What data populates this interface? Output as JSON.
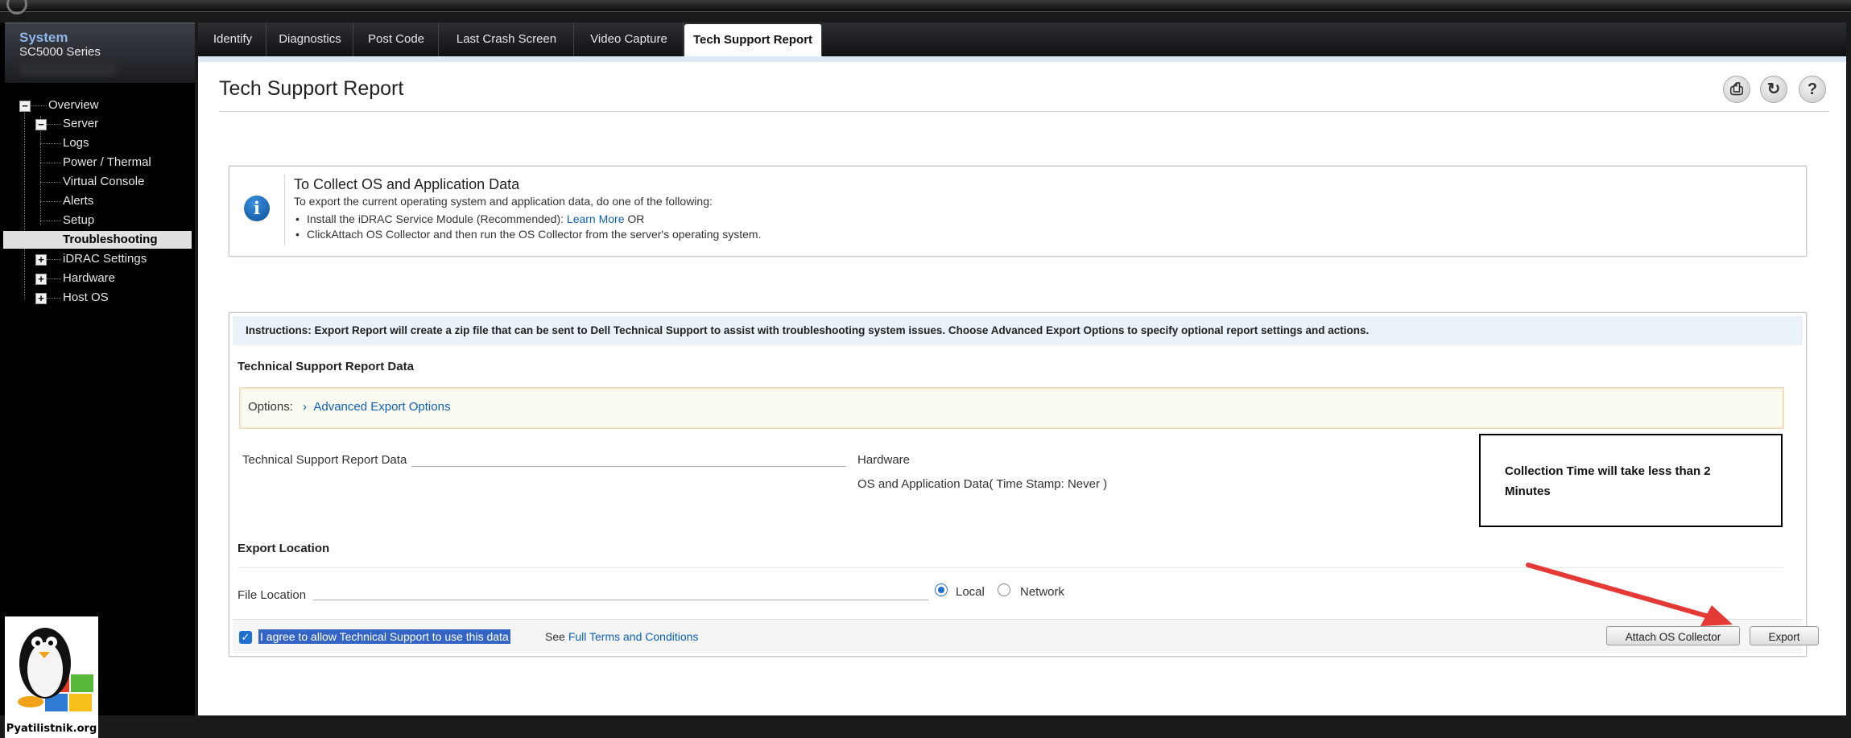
{
  "system": {
    "title": "System",
    "subtitle": "SC5000 Series"
  },
  "tree": {
    "overview": "Overview",
    "server": "Server",
    "logs": "Logs",
    "power": "Power / Thermal",
    "console": "Virtual Console",
    "alerts": "Alerts",
    "setup": "Setup",
    "troubleshooting": "Troubleshooting",
    "idrac": "iDRAC Settings",
    "hardware": "Hardware",
    "hostos": "Host OS"
  },
  "tabs": [
    "Identify",
    "Diagnostics",
    "Post Code",
    "Last Crash Screen",
    "Video Capture",
    "Tech Support Report"
  ],
  "page": {
    "title": "Tech Support Report"
  },
  "info": {
    "title": "To Collect OS and Application Data",
    "subtitle": "To export the current operating system and application data, do one of the following:",
    "bullet1_prefix": "Install the iDRAC Service Module (Recommended):",
    "bullet1_link": "Learn More",
    "bullet1_suffix": "OR",
    "bullet2": "ClickAttach OS Collector and then run the OS Collector from the server's operating system."
  },
  "report": {
    "instructions_label": "Instructions:",
    "instructions_text": "Export Report will create a zip file that can be sent to Dell Technical Support to assist with troubleshooting system issues. Choose Advanced Export Options to specify optional report settings and actions.",
    "section_title": "Technical Support Report Data",
    "options_label": "Options:",
    "options_link": "Advanced Export Options",
    "data_label": "Technical Support Report Data",
    "data_hardware": "Hardware",
    "data_os": "OS and Application Data( Time Stamp: Never )",
    "collection_time": "Collection Time will take less than 2 Minutes",
    "export_location_title": "Export Location",
    "file_location_label": "File Location",
    "radio_local": "Local",
    "radio_network": "Network",
    "agree_text": "I agree to allow Technical Support to use this data",
    "see_text": "See",
    "terms_link": "Full Terms and Conditions",
    "attach_button": "Attach OS Collector",
    "export_button": "Export"
  },
  "logo": {
    "text": "Pyatilistnik.org"
  },
  "colors": {
    "accent_link": "#0b5fb8",
    "annotation_arrow": "#e53935"
  }
}
